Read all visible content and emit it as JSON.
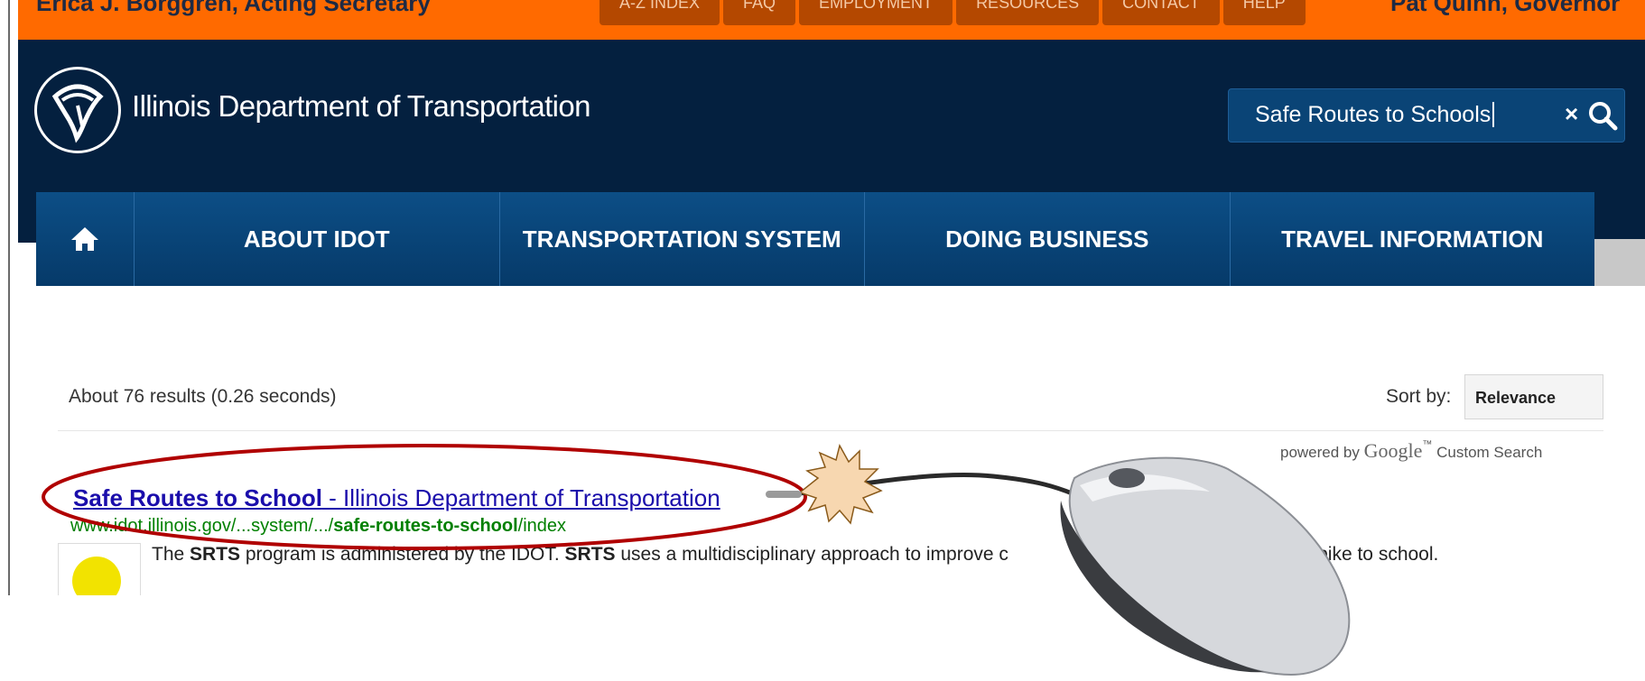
{
  "top_strip": {
    "left_text": "Erica J. Borggren, Acting Secretary",
    "right_text": "Pat Quinn, Governor",
    "links": [
      "A-Z INDEX",
      "FAQ",
      "EMPLOYMENT",
      "RESOURCES",
      "CONTACT",
      "HELP"
    ]
  },
  "header": {
    "site_title": "Illinois Department of Transportation",
    "search": {
      "value": "Safe Routes to Schools",
      "clear_glyph": "×",
      "icon": "search-icon"
    }
  },
  "main_nav": {
    "home_icon": "home-icon",
    "items": [
      "ABOUT IDOT",
      "TRANSPORTATION SYSTEM",
      "DOING BUSINESS",
      "TRAVEL INFORMATION"
    ]
  },
  "results": {
    "stats": "About 76 results (0.26 seconds)",
    "sort_label": "Sort by:",
    "sort_value": "Relevance",
    "powered_prefix": "powered by",
    "powered_google": "Google",
    "powered_tm": "™",
    "powered_suffix": "Custom Search",
    "items": [
      {
        "title_bold": "Safe Routes to School",
        "title_rest": " - Illinois Department of Transportation",
        "url_pre": "www.idot.illinois.gov/...system/.../",
        "url_bold": "safe-routes-to-school",
        "url_post": "/index",
        "snippet_1": "The ",
        "snippet_b1": "SRTS",
        "snippet_2": " program is administered by the IDOT. ",
        "snippet_b2": "SRTS",
        "snippet_3": " uses a multidisciplinary approach to improve c",
        "snippet_4": "alk or bike to school."
      }
    ]
  },
  "colors": {
    "orange": "#ff6a00",
    "navy": "#04203f",
    "nav_blue": "#0c4e86",
    "link": "#1a0dab",
    "url_green": "#008000",
    "annotation_red": "#b00000"
  }
}
